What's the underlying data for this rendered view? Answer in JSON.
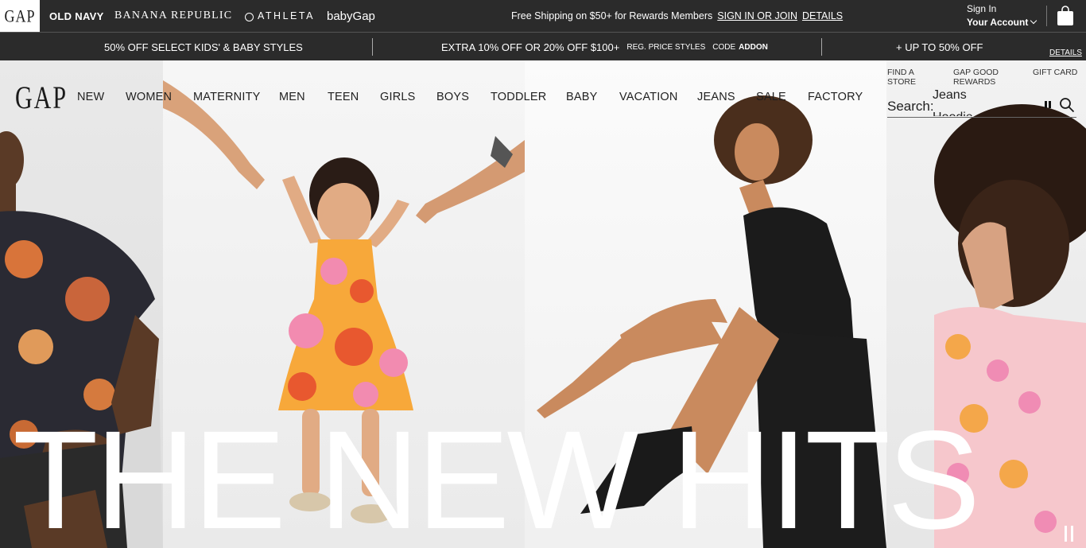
{
  "brand_bar": {
    "gap": "GAP",
    "old_navy": "OLD NAVY",
    "banana_republic": "BANANA REPUBLIC",
    "athleta": "ATHLETA",
    "babygap": "babyGap",
    "shipping_text": "Free Shipping on $50+ for Rewards Members",
    "sign_in_link": "SIGN IN OR JOIN",
    "details_link": "DETAILS",
    "account_line1": "Sign In",
    "account_line2": "Your Account"
  },
  "promo_bar": {
    "promo1": "50% OFF SELECT KIDS' & BABY STYLES",
    "promo2_main": "EXTRA 10% OFF OR 20% OFF $100+",
    "promo2_small": "REG. PRICE STYLES",
    "promo2_code_label": "CODE",
    "promo2_code": "ADDON",
    "promo3": "+ UP TO 50% OFF",
    "details": "DETAILS"
  },
  "header": {
    "logo": "GAP",
    "nav": [
      "NEW",
      "WOMEN",
      "MATERNITY",
      "MEN",
      "TEEN",
      "GIRLS",
      "BOYS",
      "TODDLER",
      "BABY",
      "VACATION",
      "JEANS",
      "SALE",
      "FACTORY"
    ],
    "utility": {
      "find_store": [
        "FIND A",
        "STORE"
      ],
      "rewards": [
        "GAP GOOD",
        "REWARDS"
      ],
      "gift_card": "GIFT CARD"
    },
    "search": {
      "label": "Search:",
      "rotating_suggestions": [
        "Jeans",
        "Hoodie"
      ]
    }
  },
  "hero": {
    "headline": "THE NEW HITS"
  },
  "colors": {
    "top_bar": "#2b2b2b",
    "text_dark": "#1f1f1f",
    "hero_text": "#ffffff"
  },
  "icons": [
    "bag-icon",
    "chevron-down-icon",
    "search-icon",
    "pause-icon",
    "athleta-logo-icon"
  ]
}
